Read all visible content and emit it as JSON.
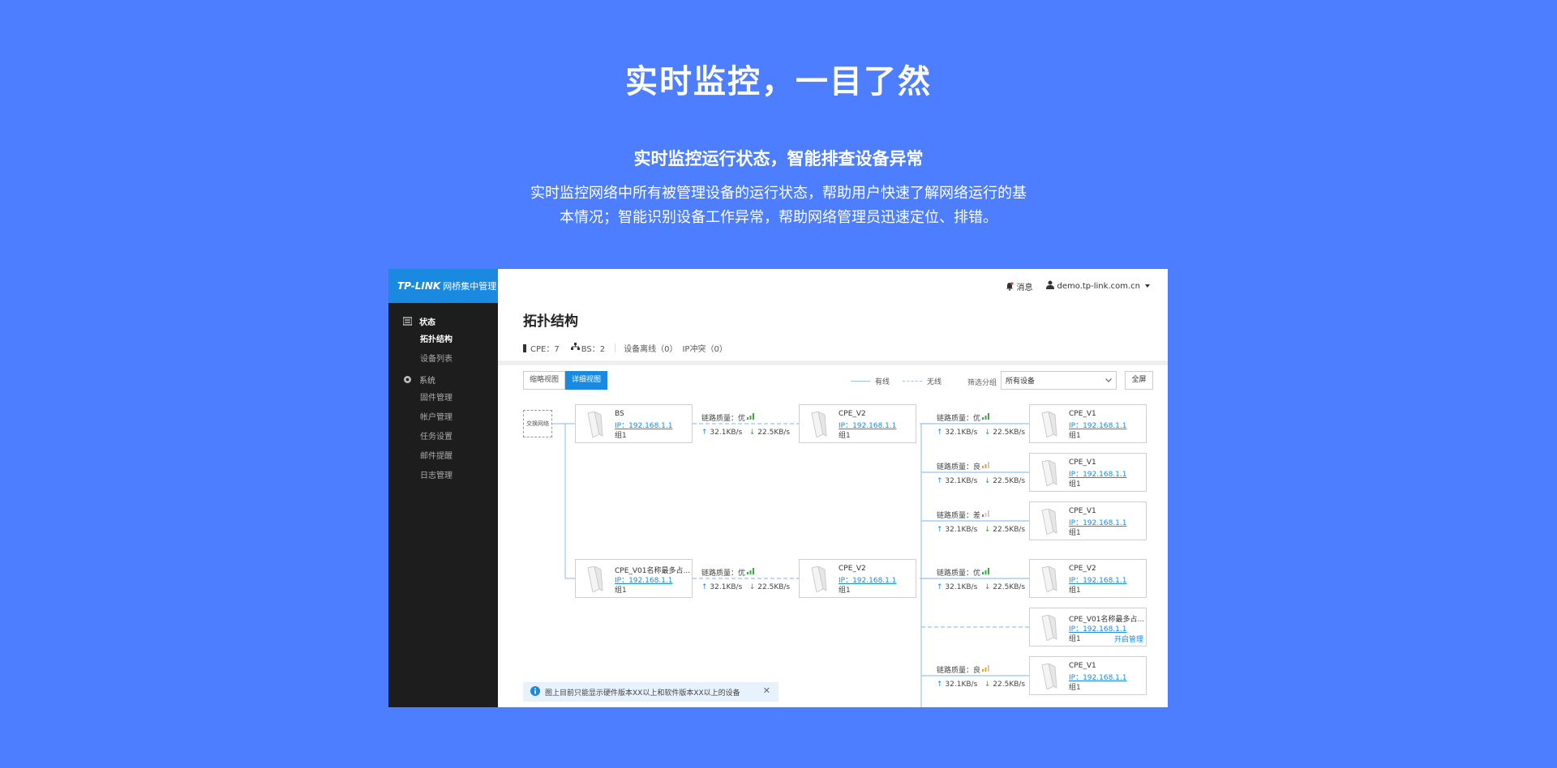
{
  "hero": {
    "title": "实时监控，一目了然",
    "subtitle": "实时监控运行状态，智能排查设备异常",
    "desc_line1": "实时监控网络中所有被管理设备的运行状态，帮助用户快速了解网络运行的基",
    "desc_line2": "本情况；智能识别设备工作异常，帮助网络管理员迅速定位、排错。"
  },
  "brand": {
    "logo": "TP-LINK",
    "name": "网桥集中管理"
  },
  "sidebar": {
    "groups": [
      {
        "label": "状态",
        "icon": "list-icon",
        "items": [
          "拓扑结构",
          "设备列表"
        ]
      },
      {
        "label": "系统",
        "icon": "gear-icon",
        "items": [
          "固件管理",
          "帐户管理",
          "任务设置",
          "邮件提醒",
          "日志管理"
        ]
      }
    ]
  },
  "topbar": {
    "messages": "消息",
    "user": "demo.tp-link.com.cn"
  },
  "page": {
    "title": "拓扑结构",
    "stats": {
      "cpe": "CPE：7",
      "bs": "BS：2",
      "offline": "设备离线（0）",
      "ip_conflict": "IP冲突（0）"
    }
  },
  "toolbar": {
    "view_brief": "缩略视图",
    "view_detail": "详细视图",
    "legend_wired": "有线",
    "legend_wireless": "无线",
    "filter_label": "筛选分组",
    "filter_value": "所有设备",
    "fullscreen": "全屏"
  },
  "switch_label": "交换网络",
  "devices": [
    {
      "name": "BS",
      "ip": "IP：192.168.1.1",
      "group": "组1"
    },
    {
      "name": "CPE_V2",
      "ip": "IP：192.168.1.1",
      "group": "组1"
    },
    {
      "name": "CPE_V1",
      "ip": "IP：192.168.1.1",
      "group": "组1"
    },
    {
      "name": "CPE_V1",
      "ip": "IP：192.168.1.1",
      "group": "组1"
    },
    {
      "name": "CPE_V1",
      "ip": "IP：192.168.1.1",
      "group": "组1"
    },
    {
      "name": "CPE_V01名称最多占...",
      "ip": "IP：192.168.1.1",
      "group": "组1"
    },
    {
      "name": "CPE_V2",
      "ip": "IP：192.168.1.1",
      "group": "组1"
    },
    {
      "name": "CPE_V2",
      "ip": "IP：192.168.1.1",
      "group": "组1"
    },
    {
      "name": "CPE_V01名称最多占...",
      "ip": "IP：192.168.1.1",
      "group": "组1",
      "action": "开启管理"
    },
    {
      "name": "CPE_V1",
      "ip": "IP：192.168.1.1",
      "group": "组1"
    }
  ],
  "links": [
    {
      "quality": "链路质量：优",
      "level": "good",
      "up": "32.1KB/s",
      "down": "22.5KB/s"
    },
    {
      "quality": "链路质量：优",
      "level": "good",
      "up": "32.1KB/s",
      "down": "22.5KB/s"
    },
    {
      "quality": "链路质量：良",
      "level": "fair",
      "up": "32.1KB/s",
      "down": "22.5KB/s"
    },
    {
      "quality": "链路质量：差",
      "level": "poor",
      "up": "32.1KB/s",
      "down": "22.5KB/s"
    },
    {
      "quality": "链路质量：优",
      "level": "good",
      "up": "32.1KB/s",
      "down": "22.5KB/s"
    },
    {
      "quality": "链路质量：优",
      "level": "good",
      "up": "32.1KB/s",
      "down": "22.5KB/s"
    },
    {
      "quality": "链路质量：良",
      "level": "fair",
      "up": "32.1KB/s",
      "down": "22.5KB/s"
    }
  ],
  "notice": "图上目前只能显示硬件版本XX以上和软件版本XX以上的设备",
  "colors": {
    "background": "#4d7eff",
    "accent": "#1a8ae0",
    "sidebar": "#1d1d1d",
    "good": "#3aa845",
    "fair": "#f0a020",
    "poor": "#e05050"
  }
}
